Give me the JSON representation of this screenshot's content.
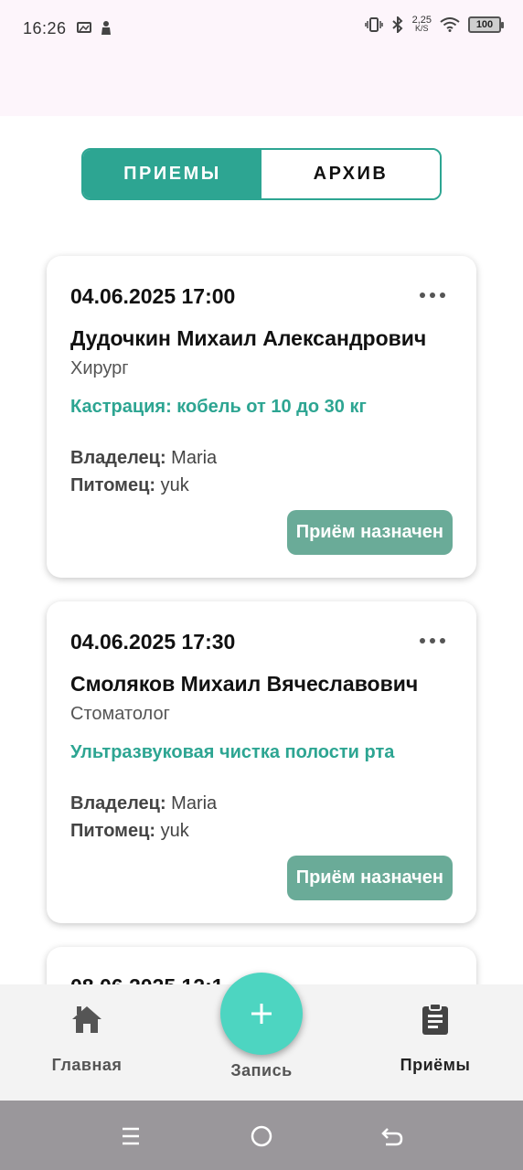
{
  "status_bar": {
    "time": "16:26",
    "speed_value": "2,25",
    "speed_unit": "K/S",
    "battery": "100"
  },
  "tabs": {
    "active_label": "ПРИЕМЫ",
    "archive_label": "АРХИВ"
  },
  "appointments": [
    {
      "datetime": "04.06.2025 17:00",
      "doctor": "Дудочкин Михаил Александрович",
      "specialty": "Хирург",
      "service": "Кастрация: кобель от 10 до 30 кг",
      "owner_label": "Владелец:",
      "owner": "Maria",
      "pet_label": "Питомец:",
      "pet": "yuk",
      "status": "Приём назначен"
    },
    {
      "datetime": "04.06.2025 17:30",
      "doctor": "Смоляков Михаил Вячеславович",
      "specialty": "Стоматолог",
      "service": "Ультразвуковая чистка полости рта",
      "owner_label": "Владелец:",
      "owner": "Maria",
      "pet_label": "Питомец:",
      "pet": "yuk",
      "status": "Приём назначен"
    },
    {
      "datetime": "08.06.2025 12:1"
    }
  ],
  "bottom_nav": {
    "home_label": "Главная",
    "add_label": "Запись",
    "appointments_label": "Приёмы"
  },
  "icons": {
    "home": "home-icon",
    "add": "plus-icon",
    "appointments": "clipboard-icon",
    "menu": "menu-icon",
    "home_sys": "circle-home-icon",
    "back": "back-icon"
  },
  "colors": {
    "accent": "#2da592",
    "fab": "#4dd5c1",
    "status_button": "#6aab98"
  }
}
